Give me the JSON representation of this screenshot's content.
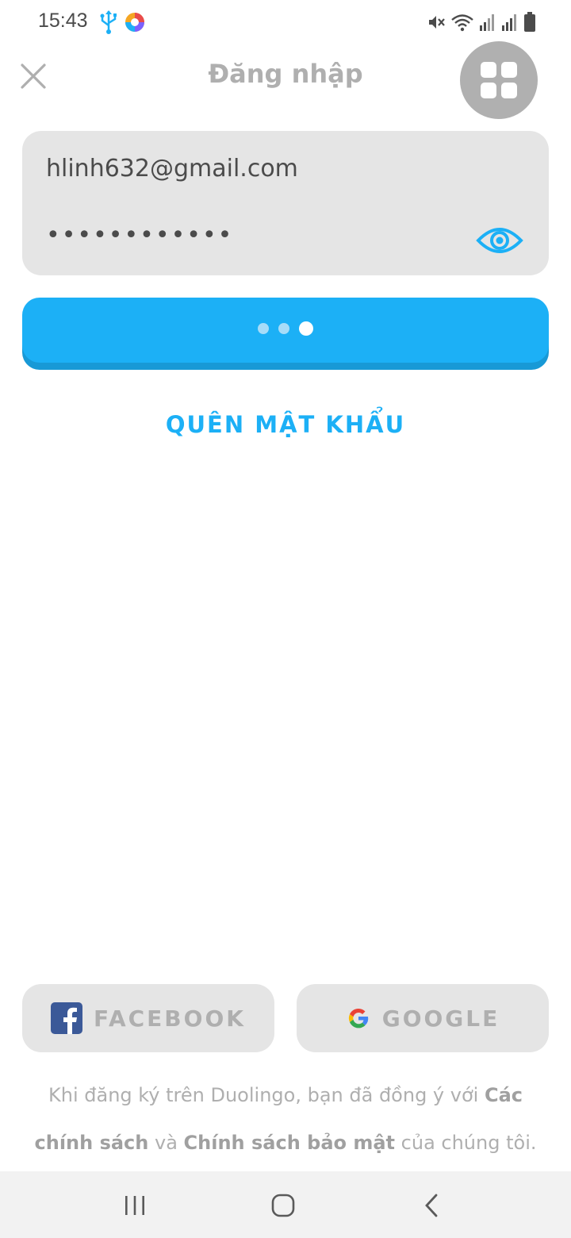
{
  "status_bar": {
    "time": "15:43"
  },
  "header": {
    "title": "Đăng nhập"
  },
  "form": {
    "email_value": "hlinh632@gmail.com",
    "password_masked": "••••••••••••"
  },
  "forgot_password_label": "QUÊN MẬT KHẨU",
  "social": {
    "facebook_label": "FACEBOOK",
    "google_label": "GOOGLE"
  },
  "terms": {
    "text_before": "Khi đăng ký trên Duolingo, bạn đã đồng ý với ",
    "policies_link": "Các chính sách",
    "and": " và ",
    "privacy_link": "Chính sách bảo mật",
    "text_after": " của chúng tôi."
  },
  "icons": {
    "close": "close-icon",
    "grid": "grid-icon",
    "eye": "eye-icon",
    "facebook": "facebook-icon",
    "google": "google-icon"
  },
  "colors": {
    "accent": "#1cb0f6",
    "accent_shadow": "#1899d6",
    "field_bg": "#e5e5e5",
    "muted_text": "#afafaf",
    "facebook_blue": "#3b5998"
  }
}
